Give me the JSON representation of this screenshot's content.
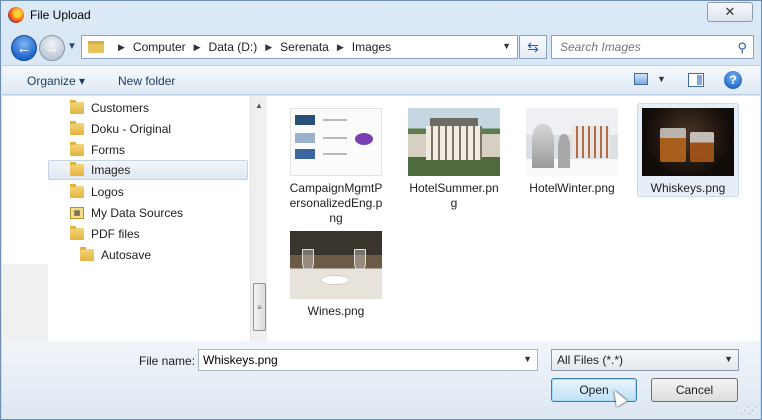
{
  "window": {
    "title": "File Upload",
    "close_glyph": "✕"
  },
  "nav": {
    "breadcrumbs": [
      "Computer",
      "Data (D:)",
      "Serenata",
      "Images"
    ],
    "search_placeholder": "Search Images"
  },
  "toolbar": {
    "organize_label": "Organize ▾",
    "new_folder_label": "New folder",
    "help_glyph": "?"
  },
  "tree": {
    "items": [
      {
        "label": "Customers"
      },
      {
        "label": "Doku - Original"
      },
      {
        "label": "Forms"
      },
      {
        "label": "Images",
        "selected": true
      },
      {
        "label": "Logos"
      },
      {
        "label": "My Data Sources"
      },
      {
        "label": "PDF files"
      },
      {
        "label": "Autosave"
      }
    ]
  },
  "files": [
    {
      "name": "CampaignMgmtPersonalizedEng.png",
      "icon": "campaign-thumbnail"
    },
    {
      "name": "HotelSummer.png",
      "icon": "hotel-summer-thumbnail"
    },
    {
      "name": "HotelWinter.png",
      "icon": "hotel-winter-thumbnail"
    },
    {
      "name": "Whiskeys.png",
      "icon": "whiskeys-thumbnail",
      "selected": true
    },
    {
      "name": "Wines.png",
      "icon": "wines-thumbnail"
    }
  ],
  "bottom": {
    "file_name_label": "File name:",
    "file_name_value": "Whiskeys.png",
    "file_type": "All Files (*.*)",
    "open_label": "Open",
    "cancel_label": "Cancel"
  },
  "colors": {
    "selection": "#e6eef8",
    "accent": "#1f64c9"
  }
}
